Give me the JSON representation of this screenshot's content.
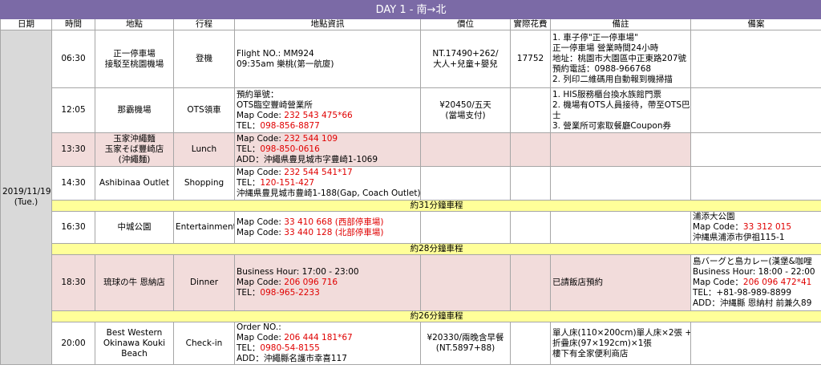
{
  "title": "DAY 1 - 南→北",
  "headers": [
    "日期",
    "時間",
    "地點",
    "行程",
    "地點資訊",
    "價位",
    "實際花費",
    "備註",
    "備案"
  ],
  "date": {
    "line1": "2019/11/19",
    "line2": "(Tue.)"
  },
  "rows": [
    {
      "time": "06:30",
      "place": [
        "正一停車場",
        "接駁至桃園機場"
      ],
      "activity": "登機",
      "info": [
        {
          "t": "Flight NO.: MM924",
          "red": ""
        },
        {
          "t": "09:35am 樂桃(第一航廈)",
          "red": ""
        }
      ],
      "price": [
        "NT.17490+262/",
        "大人+兒童+嬰兒"
      ],
      "spent": "17752",
      "note": [
        "1. 車子停\"正一停車場\"",
        "正一停車場 營業時間24小時",
        "地址：桃園市大園區中正東路207號",
        "預約電話：0988-966768",
        "2. 列印二維碼用自動報到機掃描"
      ],
      "backup": []
    },
    {
      "time": "12:05",
      "place": [
        "那霸機場"
      ],
      "activity": "OTS領車",
      "info": [
        {
          "t": "預約單號：",
          "red": ""
        },
        {
          "t": "OTS臨空豐崎營業所",
          "red": ""
        },
        {
          "t": "Map Code: ",
          "red": "232 543 475*66"
        },
        {
          "t": "TEL：",
          "red": "098-856-8877"
        }
      ],
      "price": [
        "¥20450/五天",
        "(當場支付)"
      ],
      "spent": "",
      "note": [
        "1. HIS服務櫃台換水族館門票",
        "2. 機場有OTS人員接待，帶至OTS巴",
        "士",
        "3. 營業所可索取餐廳Coupon券"
      ],
      "backup": []
    },
    {
      "time": "13:30",
      "place": [
        "玉家沖繩麵",
        "玉家そば豐崎店",
        "(沖繩麵)"
      ],
      "activity": "Lunch",
      "info": [
        {
          "t": "Map Code: ",
          "red": "232 544 109"
        },
        {
          "t": "TEL：",
          "red": "098-850-0616"
        },
        {
          "t": "ADD：沖繩県豊見城市字豊崎1-1069",
          "red": ""
        }
      ],
      "price": [],
      "spent": "",
      "note": [],
      "backup": []
    },
    {
      "time": "14:30",
      "place": [
        "Ashibinaa Outlet"
      ],
      "activity": "Shopping",
      "info": [
        {
          "t": "Map Code: ",
          "red": "232 544 541*17"
        },
        {
          "t": "TEL：",
          "red": "120-151-427"
        },
        {
          "t": "沖縄県豊見城市豊崎1-188(Gap, Coach Outlet)",
          "red": ""
        }
      ],
      "price": [],
      "spent": "",
      "note": [],
      "backup": []
    },
    {
      "time": "16:30",
      "place": [
        "中城公園"
      ],
      "activity": "Entertainment",
      "info": [
        {
          "t": "Map Code: ",
          "red": "33 410 668 (西部停車場)"
        },
        {
          "t": "Map Code: ",
          "red": "33 440 128 (北部停車場)"
        }
      ],
      "price": [],
      "spent": "",
      "note": [],
      "backup": [
        {
          "t": "浦添大公園",
          "red": ""
        },
        {
          "t": "Map Code：",
          "red": "33 312 015"
        },
        {
          "t": "沖縄県浦添市伊祖115-1",
          "red": ""
        }
      ]
    },
    {
      "time": "18:30",
      "place": [
        "琉球の牛 恩納店"
      ],
      "activity": "Dinner",
      "info": [
        {
          "t": "Business Hour: 17:00 - 23:00",
          "red": ""
        },
        {
          "t": "Map Code: ",
          "red": "206 096 716"
        },
        {
          "t": "TEL：",
          "red": "098-965-2233"
        }
      ],
      "price": [],
      "spent": "",
      "note": [
        "已請飯店預約"
      ],
      "backup": [
        {
          "t": "島バーグと島カレー(漢堡&咖哩",
          "red": ""
        },
        {
          "t": "Business Hour: 18:00 - 22:00",
          "red": ""
        },
        {
          "t": "Map Code：",
          "red": "206 096 472*41"
        },
        {
          "t": "TEL：+81-98-989-8899",
          "red": ""
        },
        {
          "t": "ADD：沖縄縣 恩納村 前兼久89",
          "red": ""
        }
      ]
    },
    {
      "time": "20:00",
      "place": [
        "Best Western",
        "Okinawa Kouki",
        "Beach"
      ],
      "activity": "Check-in",
      "info": [
        {
          "t": "Order NO.:",
          "red": ""
        },
        {
          "t": "Map Code: ",
          "red": "206 444 181*67"
        },
        {
          "t": "TEL：",
          "red": "0980-54-8155"
        },
        {
          "t": "ADD：沖繩縣名護市幸喜117",
          "red": ""
        }
      ],
      "price": [
        "¥20330/兩晚含早餐",
        "(NT.5897+88)"
      ],
      "spent": "",
      "note": [
        "單人床(110×200cm)單人床×2張 +",
        "折疊床(97×192cm)×1張",
        "樓下有全家便利商店"
      ],
      "backup": []
    }
  ],
  "drives": [
    "約31分鐘車程",
    "約28分鐘車程",
    "約26分鐘車程"
  ]
}
